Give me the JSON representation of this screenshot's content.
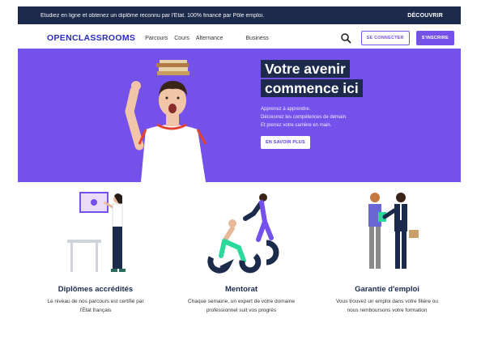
{
  "banner": {
    "message": "Etudiez en ligne et obtenez un diplôme reconnu par l'Etat. 100% financé par Pôle emploi.",
    "cta": "DÉCOUVRIR"
  },
  "nav": {
    "logo": "OPENCLASSROOMS",
    "links": [
      "Parcours",
      "Cours",
      "Alternance",
      "Business"
    ],
    "login": "SE CONNECTER",
    "signup": "S'INSCRIRE"
  },
  "hero": {
    "title_line1": "Votre avenir",
    "title_line2": "commence ici",
    "subtitle_lines": [
      "Apprenez à apprendre.",
      "Découvrez les compétences de demain.",
      "Et prenez votre carrière en main."
    ],
    "button": "EN SAVOIR PLUS"
  },
  "features": [
    {
      "title": "Diplômes accrédités",
      "desc_line1": "Le niveau de nos parcours est certifié par",
      "desc_line2": "l'État français"
    },
    {
      "title": "Mentorat",
      "desc_line1": "Chaque semaine, un expert de votre domaine",
      "desc_line2": "professionnel suit vos progrès"
    },
    {
      "title": "Garantie d'emploi",
      "desc_line1": "Vous trouvez un emploi dans votre filière ou",
      "desc_line2": "nous remboursons votre formation"
    }
  ],
  "colors": {
    "banner": "#1c2a4c",
    "accent": "#7451eb",
    "hero_bg": "#7451eb"
  }
}
